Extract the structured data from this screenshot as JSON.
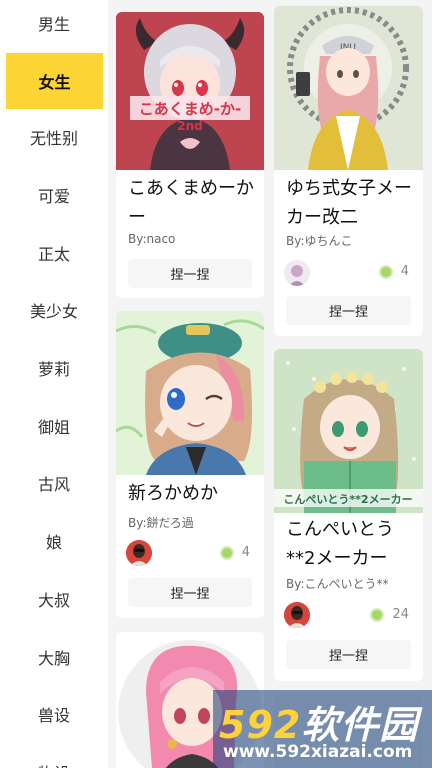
{
  "sidebar": {
    "items": [
      {
        "label": "男生"
      },
      {
        "label": "女生"
      },
      {
        "label": "无性别"
      },
      {
        "label": "可爱"
      },
      {
        "label": "正太"
      },
      {
        "label": "美少女"
      },
      {
        "label": "萝莉"
      },
      {
        "label": "御姐"
      },
      {
        "label": "古风"
      },
      {
        "label": "娘"
      },
      {
        "label": "大叔"
      },
      {
        "label": "大胸"
      },
      {
        "label": "兽设"
      },
      {
        "label": "物设"
      }
    ],
    "active_index": 1
  },
  "cards": [
    {
      "title": "こあくまめーかー",
      "author": "By:naco",
      "image_text": "こあくまめ-か-",
      "image_subtext": "2nd",
      "button": "捏一捏"
    },
    {
      "title": "ゆち式女子メーカー改二",
      "author": "By:ゆちんこ",
      "likes": "4",
      "button": "捏一捏"
    },
    {
      "title": "新ろかめか",
      "author": "By:餅だろ過",
      "likes": "4",
      "button": "捏一捏"
    },
    {
      "title": "こんぺいとう**2メーカー",
      "author": "By:こんぺいとう**",
      "likes": "24",
      "image_text": "こんぺいとう**2メーカー",
      "button": "捏一捏"
    }
  ],
  "watermark": {
    "num": "592",
    "text": "软件园",
    "url": "www.592xiazai.com"
  },
  "colors": {
    "accent": "#fcd534",
    "like_dot": "#a6d865"
  }
}
